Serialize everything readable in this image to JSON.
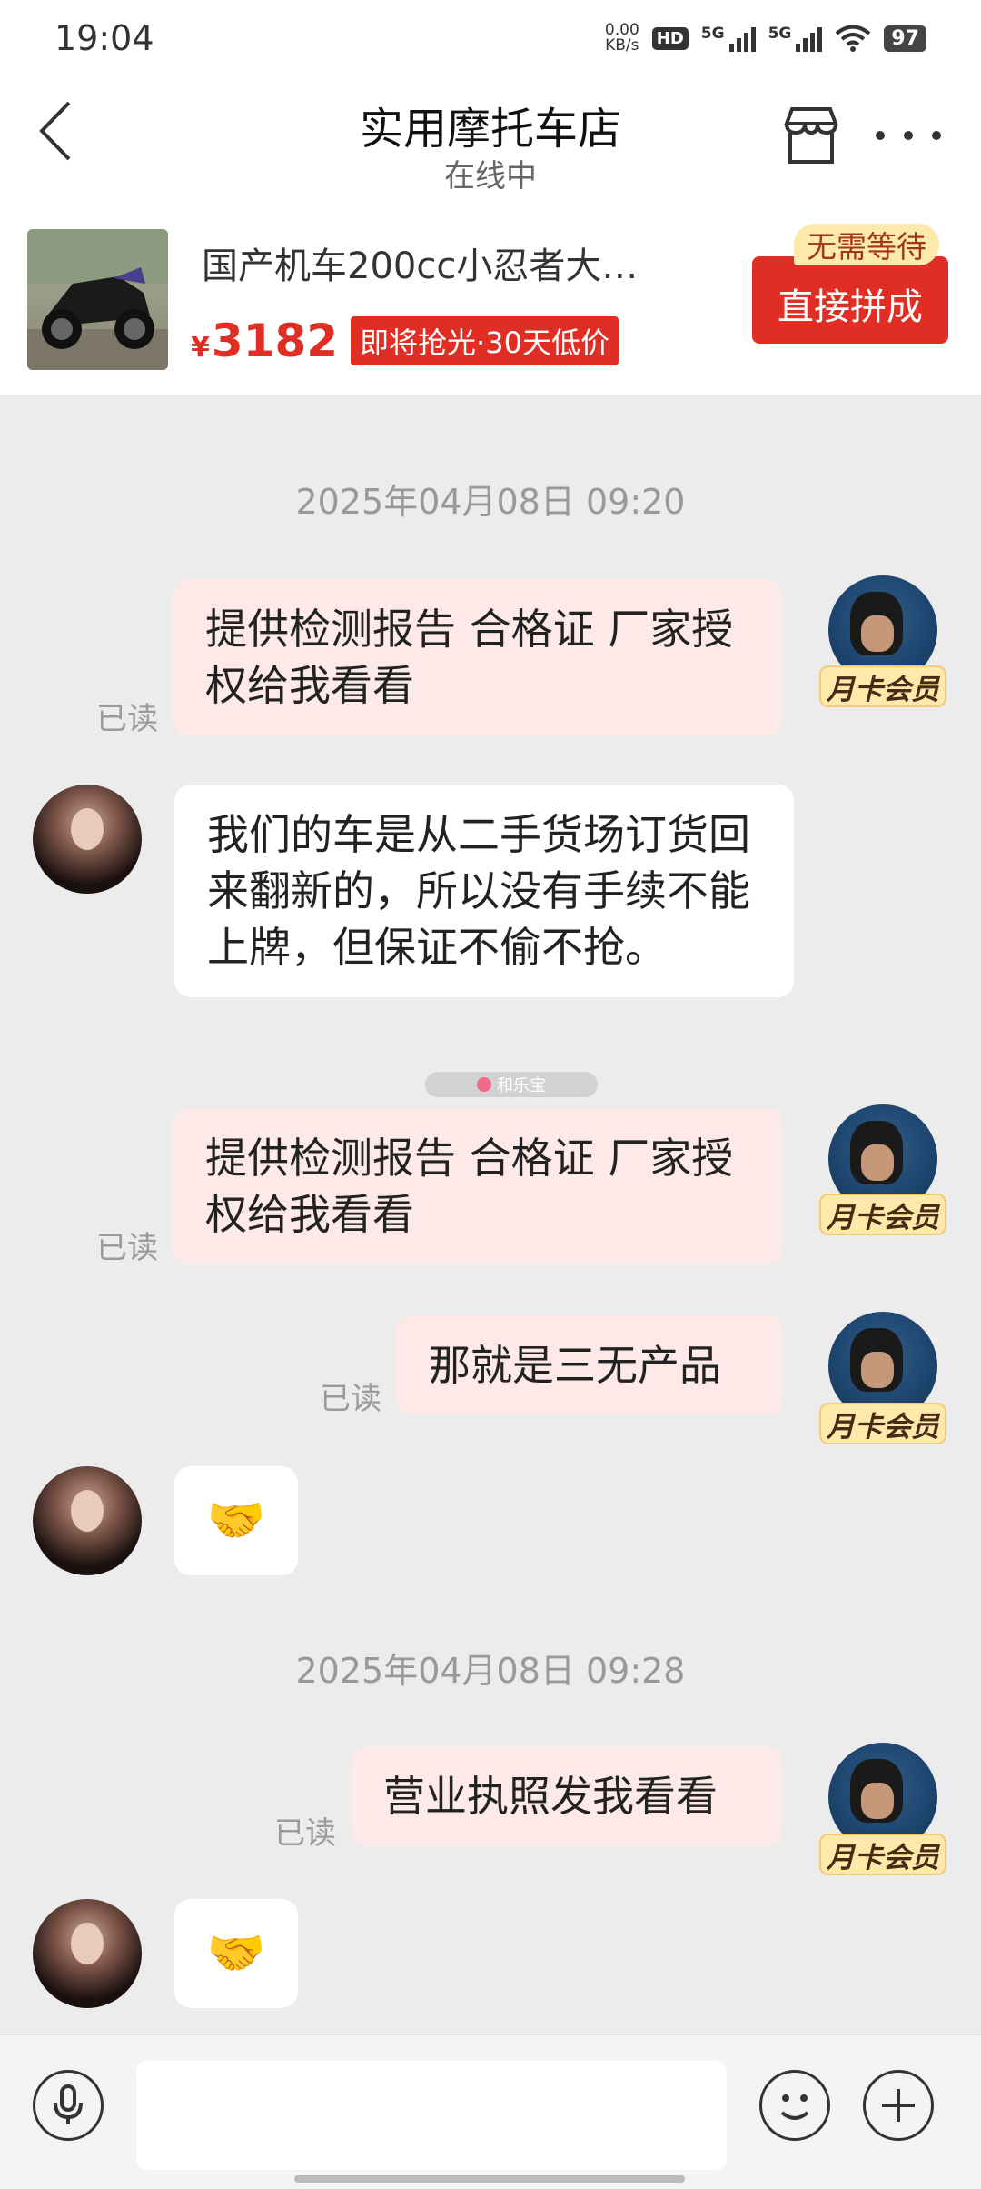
{
  "status_bar": {
    "time": "19:04",
    "net_speed_value": "0.00",
    "net_speed_unit": "KB/s",
    "hd_label": "HD",
    "sim1_label": "5G",
    "sim2_label": "5G",
    "battery": "97"
  },
  "header": {
    "title": "实用摩托车店",
    "subtitle": "在线中"
  },
  "product": {
    "title": "国产机车200cc小忍者大…",
    "price_currency": "¥",
    "price": "3182",
    "promo_tag": "即将抢光·30天低价",
    "buy_button": "直接拼成",
    "buy_badge": "无需等待"
  },
  "chat": {
    "timestamps": [
      "2025年04月08日 09:20",
      "2025年04月08日 09:28"
    ],
    "read_label": "已读",
    "vip_label": "月卡会员",
    "messages": [
      {
        "side": "out",
        "text": "提供检测报告 合格证  厂家授权给我看看",
        "read": "已读"
      },
      {
        "side": "in",
        "text": "我们的车是从二手货场订货回来翻新的，所以没有手续不能上牌，但保证不偷不抢。"
      },
      {
        "side": "out",
        "text": "提供检测报告 合格证  厂家授权给我看看",
        "read": "已读"
      },
      {
        "side": "out",
        "text": "那就是三无产品",
        "read": "已读"
      },
      {
        "side": "in",
        "text": "🤝"
      },
      {
        "side": "out",
        "text": "营业执照发我看看",
        "read": "已读"
      },
      {
        "side": "in",
        "text": "🤝"
      }
    ],
    "watermark": "和乐宝"
  },
  "input": {
    "placeholder": ""
  },
  "colors": {
    "accent": "#e02e24",
    "outgoing_bubble": "#fde9e7",
    "incoming_bubble": "#ffffff",
    "chat_background": "#ececec",
    "vip_badge": "#fde9a9"
  },
  "icons": [
    "back-arrow-icon",
    "shop-icon",
    "more-icon",
    "mic-icon",
    "emoji-icon",
    "plus-icon",
    "wifi-icon",
    "handshake-icon"
  ]
}
